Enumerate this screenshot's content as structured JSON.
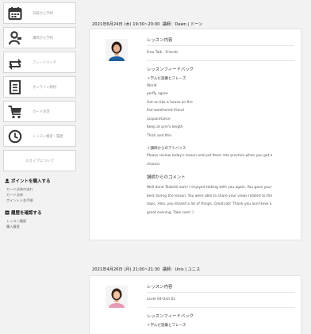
{
  "sidebar": {
    "nav": [
      {
        "label": "日程から予約"
      },
      {
        "label": "講師から予約"
      },
      {
        "label": "フィードバック"
      },
      {
        "label": "オンライン教材"
      },
      {
        "label": "カード決済"
      },
      {
        "label": "レッスン検索・履歴"
      },
      {
        "label": "スカイプについて"
      }
    ],
    "points": {
      "heading": "ポイントを購入する",
      "items": [
        "カード決済の流れ",
        "カード決済",
        "ポイント入金手順"
      ]
    },
    "security": {
      "heading": "履歴を確認する",
      "items": [
        "レッスン履歴",
        "購入履歴"
      ]
    }
  },
  "lessons": [
    {
      "date": "2021年6月24日 (木) 19:30~20:00",
      "teacher_label": "講師：Dawn | ドーン",
      "content_title": "レッスン内容",
      "content": "Free Talk - Friends",
      "feedback_title": "レッスンフィードバック",
      "phrases_title": "＋学んだ語彙とフレーズ",
      "phrases": [
        "World",
        "perfly agree",
        "Get on like a house on fire",
        "Fair-weathered friend",
        "acquaintance",
        "Keep at arm's length",
        "Thick and thin"
      ],
      "advice_title": "＋講師からのアドバイス",
      "advice_lines": [
        "Please review today's lesson and put them into practice when you get a",
        "chance."
      ],
      "comment_title": "講師からのコメント",
      "comment_lines": [
        "Well done Tadashi-sam! I enjoyed talking with you again. You gave your",
        "best during the lesson. You were able to share your views related to the",
        "topic. Also, you shared a lot of things. Great Job! Thank you and Have a",
        "great evening. Take care! )"
      ]
    },
    {
      "date": "2021年4月26日 (月) 21:00~21:30",
      "teacher_label": "講師：Unis | ユニス",
      "content_title": "レッスン内容",
      "content": "Level 04-Unit 02",
      "feedback_title": "レッスンフィードバック",
      "phrases_title": "＋学んだ語彙とフレーズ"
    }
  ],
  "colors": {
    "icon": "#3a3a3a",
    "card_border": "#e2e2e2",
    "page_bg": "#f2f2f2"
  }
}
